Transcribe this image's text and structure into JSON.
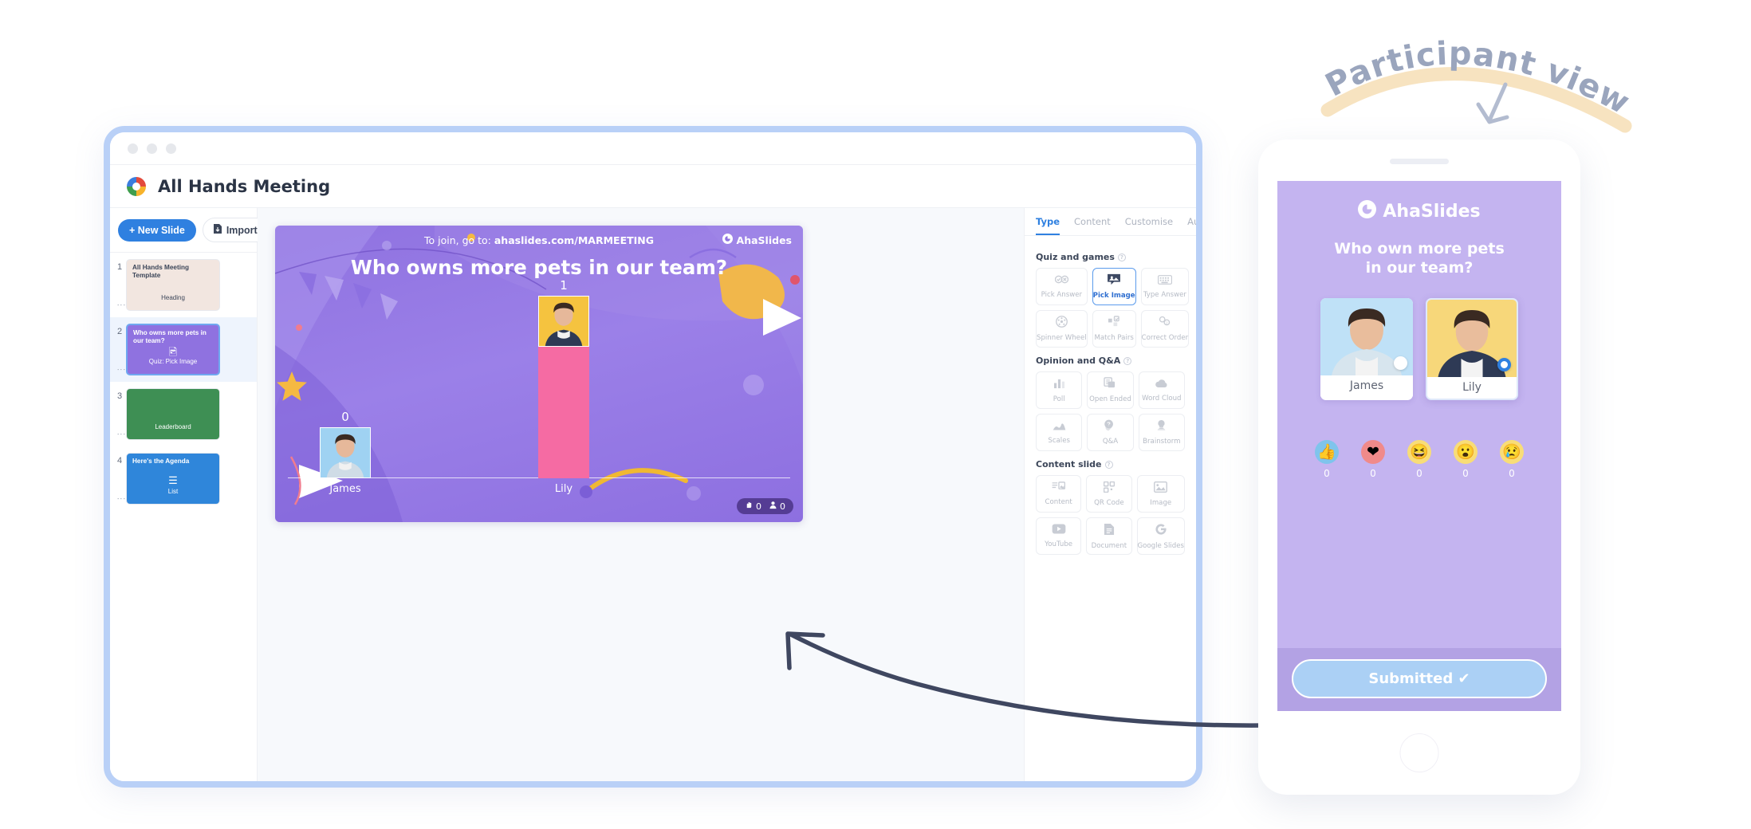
{
  "annotation": {
    "label": "Participant view",
    "highlight_color": "#f7e3c0",
    "text_color": "#9aa5bd",
    "arrow_icon": "down-left-arrow-icon"
  },
  "browser": {
    "border_color": "#b9d0f7",
    "traffic_lights": [
      "dot-1",
      "dot-2",
      "dot-3"
    ]
  },
  "header": {
    "logo_icon": "ahaslides-logo-icon",
    "title": "All Hands Meeting"
  },
  "slides_panel": {
    "new_slide_label": "+ New Slide",
    "import_label": "Import",
    "import_icon": "import-file-icon",
    "slides": [
      {
        "number": "1",
        "title": "All Hands Meeting Template",
        "type_label": "Heading",
        "badge": "Heading",
        "icon": "heading-icon",
        "selected": false,
        "bg": "#f2e6e0",
        "title_color": "#3c4659",
        "type_color": "#3c4659"
      },
      {
        "number": "2",
        "title": "Who owns more pets in our team?",
        "type_label": "Quiz: Pick Image",
        "icon": "image-icon",
        "selected": true,
        "bg": "#8f72e0",
        "title_color": "#ffffff",
        "type_color": "#ffffff"
      },
      {
        "number": "3",
        "title": "",
        "type_label": "Leaderboard",
        "icon": "",
        "selected": false,
        "bg": "#3e8f54",
        "title_color": "#ffffff",
        "type_color": "#ffffff"
      },
      {
        "number": "4",
        "title": "Here's the Agenda",
        "type_label": "List",
        "icon": "list-icon",
        "selected": false,
        "bg": "#2f86da",
        "title_color": "#ffffff",
        "type_color": "#ffffff"
      }
    ]
  },
  "slide_stage": {
    "join_prefix": "To join, go to: ",
    "join_code": "ahaslides.com/MARMEETING",
    "brand": "AhaSlides",
    "brand_icon": "ahaslides-mark-icon",
    "question": "Who owns more pets in our team?",
    "hand_count": "0",
    "people_count": "0",
    "hand_icon": "raised-hand-icon",
    "people_icon": "person-icon"
  },
  "chart_data": {
    "type": "bar",
    "title": "Who owns more pets in our team?",
    "categories": [
      "James",
      "Lily"
    ],
    "values": [
      0,
      1
    ],
    "value_labels": [
      "0",
      "1"
    ],
    "ylim": [
      0,
      1
    ],
    "xlabel": "",
    "ylabel": "",
    "grid": false,
    "legend": "none",
    "bar_colors": [
      "#8f72e0",
      "#f56ba3"
    ],
    "bars": [
      {
        "label": "James",
        "value": 0,
        "value_label": "0",
        "color": "#8f72e0",
        "photo_bg": "#9fd2f2"
      },
      {
        "label": "Lily",
        "value": 1,
        "value_label": "1",
        "color": "#f56ba3",
        "photo_bg": "#f5c33f"
      }
    ]
  },
  "inspector": {
    "tabs": [
      {
        "label": "Type",
        "active": true
      },
      {
        "label": "Content",
        "active": false
      },
      {
        "label": "Customise",
        "active": false
      },
      {
        "label": "Audio",
        "active": false
      }
    ],
    "sections": [
      {
        "title": "Quiz and games",
        "help_icon": "help-circle-icon",
        "cards": [
          {
            "label": "Pick Answer",
            "icon": "check-cross-icon",
            "glyph": "✔✖",
            "active": false
          },
          {
            "label": "Pick Image",
            "icon": "image-pick-icon",
            "glyph": "🖼",
            "active": true
          },
          {
            "label": "Type Answer",
            "icon": "keyboard-icon",
            "glyph": "⌨",
            "active": false
          },
          {
            "label": "Spinner Wheel",
            "icon": "spinner-wheel-icon",
            "glyph": "☸",
            "active": false
          },
          {
            "label": "Match Pairs",
            "icon": "match-pairs-icon",
            "glyph": "▣",
            "active": false
          },
          {
            "label": "Correct Order",
            "icon": "correct-order-icon",
            "glyph": "②",
            "active": false
          }
        ]
      },
      {
        "title": "Opinion and Q&A",
        "help_icon": "help-circle-icon",
        "cards": [
          {
            "label": "Poll",
            "icon": "bar-chart-icon",
            "glyph": "📊",
            "active": false
          },
          {
            "label": "Open Ended",
            "icon": "open-ended-icon",
            "glyph": "🗒",
            "active": false
          },
          {
            "label": "Word Cloud",
            "icon": "cloud-icon",
            "glyph": "☁",
            "active": false
          },
          {
            "label": "Scales",
            "icon": "scales-icon",
            "glyph": "▲",
            "active": false
          },
          {
            "label": "Q&A",
            "icon": "question-bubble-icon",
            "glyph": "❓",
            "active": false
          },
          {
            "label": "Brainstorm",
            "icon": "lightbulb-icon",
            "glyph": "💡",
            "active": false
          }
        ]
      },
      {
        "title": "Content slide",
        "help_icon": "help-circle-icon",
        "cards": [
          {
            "label": "Content",
            "icon": "content-layout-icon",
            "glyph": "☷",
            "active": false
          },
          {
            "label": "QR Code",
            "icon": "qr-code-icon",
            "glyph": "⬛",
            "active": false
          },
          {
            "label": "Image",
            "icon": "image-icon",
            "glyph": "🖼",
            "active": false
          },
          {
            "label": "YouTube",
            "icon": "youtube-icon",
            "glyph": "▶",
            "active": false
          },
          {
            "label": "Document",
            "icon": "document-icon",
            "glyph": "📄",
            "active": false
          },
          {
            "label": "Google Slides",
            "icon": "google-icon",
            "glyph": "G",
            "active": false
          }
        ]
      }
    ]
  },
  "phone": {
    "brand": "AhaSlides",
    "brand_icon": "ahaslides-mark-icon",
    "question": "Who own more pets\nin our team?",
    "options": [
      {
        "name": "James",
        "photo_bg": "#bfe1f7",
        "selected": false
      },
      {
        "name": "Lily",
        "photo_bg": "#f7d77a",
        "selected": true
      }
    ],
    "reactions": [
      {
        "icon": "thumbs-up-icon",
        "glyph": "👍",
        "bg": "#7fc4ec",
        "count": "0"
      },
      {
        "icon": "heart-icon",
        "glyph": "❤",
        "bg": "#f08a8a",
        "count": "0"
      },
      {
        "icon": "laugh-icon",
        "glyph": "😆",
        "bg": "#f8dd77",
        "count": "0"
      },
      {
        "icon": "surprised-icon",
        "glyph": "😮",
        "bg": "#f8dd77",
        "count": "0"
      },
      {
        "icon": "sad-icon",
        "glyph": "😢",
        "bg": "#f8dd77",
        "count": "0"
      }
    ],
    "submit_label": "Submitted",
    "submit_icon": "check-icon",
    "home_icon": "home-button-icon"
  }
}
